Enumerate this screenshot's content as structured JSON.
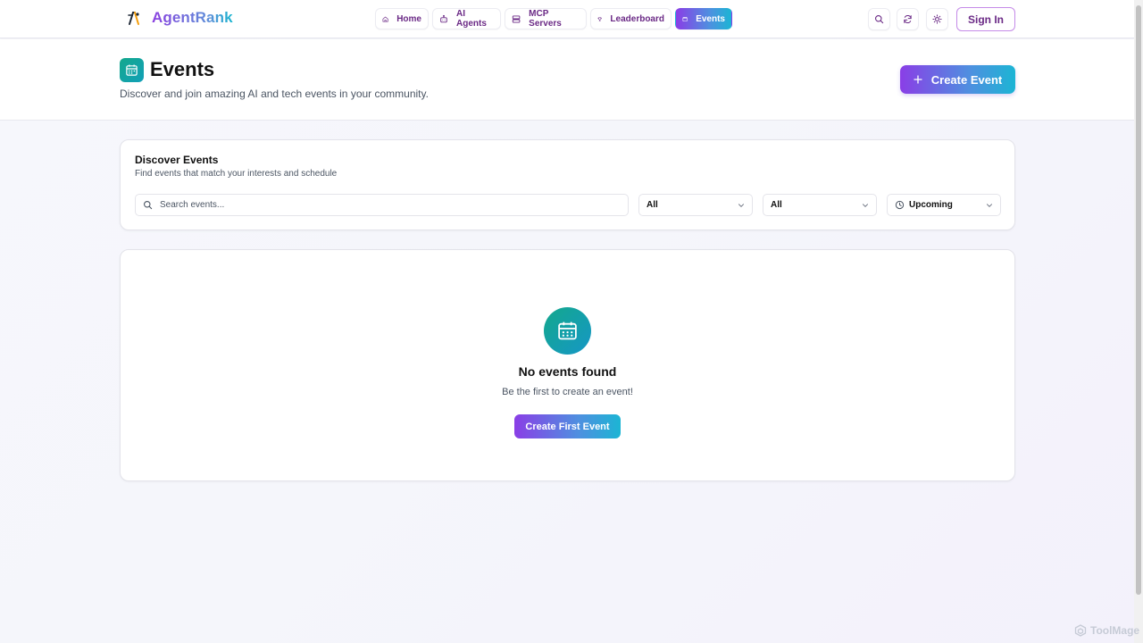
{
  "brand": {
    "name": "AgentRank"
  },
  "nav": {
    "items": [
      {
        "label": "Home",
        "icon": "home-icon"
      },
      {
        "label": "AI Agents",
        "icon": "bot-icon"
      },
      {
        "label": "MCP Servers",
        "icon": "server-icon"
      },
      {
        "label": "Leaderboard",
        "icon": "trophy-icon"
      },
      {
        "label": "Events",
        "icon": "calendar-icon",
        "active": true
      }
    ],
    "sign_in": "Sign In"
  },
  "header": {
    "title": "Events",
    "subtitle": "Discover and join amazing AI and tech events in your community.",
    "create_button": "Create Event"
  },
  "discover": {
    "title": "Discover Events",
    "subtitle": "Find events that match your interests and schedule",
    "search_placeholder": "Search events...",
    "filter_1": "All",
    "filter_2": "All",
    "filter_3": "Upcoming"
  },
  "empty_state": {
    "title": "No events found",
    "subtitle": "Be the first to create an event!",
    "button": "Create First Event"
  },
  "watermark": "ToolMage",
  "colors": {
    "accent_start": "#8a3ee6",
    "accent_end": "#1cb5d4",
    "nav_text": "#6b2a86",
    "teal": "#14a88c"
  }
}
